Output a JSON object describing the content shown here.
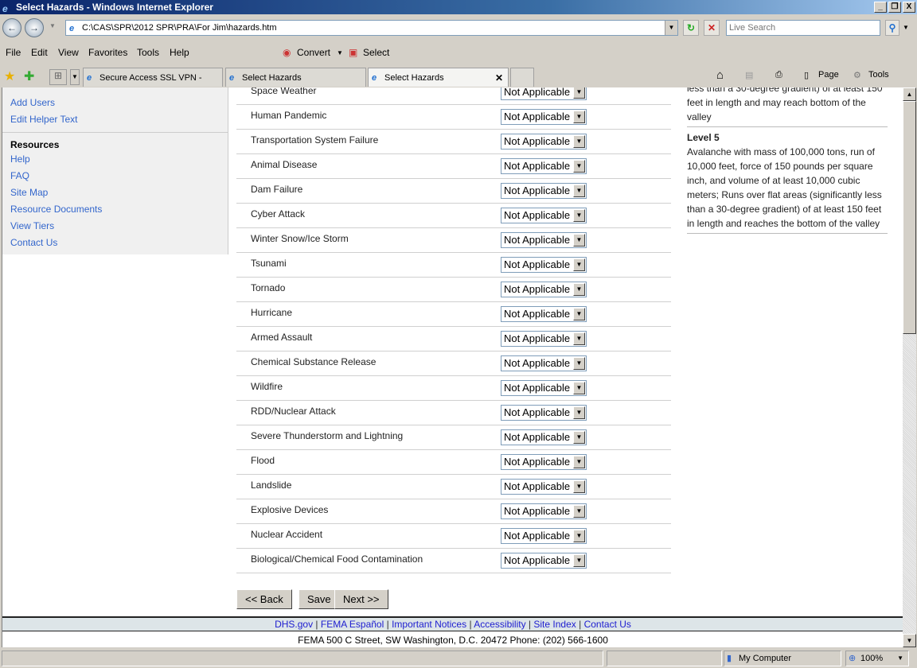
{
  "window": {
    "title": "Select Hazards - Windows Internet Explorer"
  },
  "address": {
    "url": "C:\\CAS\\SPR\\2012 SPR\\PRA\\For Jim\\hazards.htm",
    "search_placeholder": "Live Search"
  },
  "menu": [
    "File",
    "Edit",
    "View",
    "Favorites",
    "Tools",
    "Help"
  ],
  "toolbar": {
    "convert": "Convert",
    "select": "Select",
    "page": "Page",
    "tools": "Tools"
  },
  "tabs": [
    {
      "label": "Secure Access SSL VPN - Home"
    },
    {
      "label": "Select Hazards"
    },
    {
      "label": "Select Hazards",
      "active": true
    }
  ],
  "sidebar": {
    "links": [
      "Add Users",
      "Edit Helper Text"
    ],
    "resources_header": "Resources",
    "resources": [
      "Help",
      "FAQ",
      "Site Map",
      "Resource Documents",
      "View Tiers",
      "Contact Us"
    ]
  },
  "hazards": [
    {
      "name": "Space Weather",
      "value": "Not Applicable"
    },
    {
      "name": "Human Pandemic",
      "value": "Not Applicable"
    },
    {
      "name": "Transportation System Failure",
      "value": "Not Applicable"
    },
    {
      "name": "Animal Disease",
      "value": "Not Applicable"
    },
    {
      "name": "Dam Failure",
      "value": "Not Applicable"
    },
    {
      "name": "Cyber Attack",
      "value": "Not Applicable"
    },
    {
      "name": "Winter Snow/Ice Storm",
      "value": "Not Applicable"
    },
    {
      "name": "Tsunami",
      "value": "Not Applicable"
    },
    {
      "name": "Tornado",
      "value": "Not Applicable"
    },
    {
      "name": "Hurricane",
      "value": "Not Applicable"
    },
    {
      "name": "Armed Assault",
      "value": "Not Applicable"
    },
    {
      "name": "Chemical Substance Release",
      "value": "Not Applicable"
    },
    {
      "name": "Wildfire",
      "value": "Not Applicable"
    },
    {
      "name": "RDD/Nuclear Attack",
      "value": "Not Applicable"
    },
    {
      "name": "Severe Thunderstorm and Lightning",
      "value": "Not Applicable"
    },
    {
      "name": "Flood",
      "value": "Not Applicable"
    },
    {
      "name": "Landslide",
      "value": "Not Applicable"
    },
    {
      "name": "Explosive Devices",
      "value": "Not Applicable"
    },
    {
      "name": "Nuclear Accident",
      "value": "Not Applicable"
    },
    {
      "name": "Biological/Chemical Food Contamination",
      "value": "Not Applicable"
    }
  ],
  "help": {
    "prev_tail": "less than a 30-degree gradient) of at least 150 feet in length and may reach bottom of the valley",
    "level_title": "Level 5",
    "level_text": "Avalanche with mass of 100,000 tons, run of 10,000 feet, force of 150 pounds per square inch, and volume of at least 10,000 cubic meters; Runs over flat areas (significantly less than a 30-degree gradient) of at least 150 feet in length and reaches the bottom of the valley"
  },
  "buttons": {
    "back": "<< Back",
    "save": "Save",
    "next": "Next >>"
  },
  "footer": {
    "links": [
      "DHS.gov",
      "FEMA Español",
      "Important Notices",
      "Accessibility",
      "Site Index",
      "Contact Us"
    ],
    "address": "FEMA 500 C Street, SW Washington, D.C. 20472 Phone: (202) 566-1600"
  },
  "status": {
    "zone": "My Computer",
    "zoom": "100%"
  }
}
